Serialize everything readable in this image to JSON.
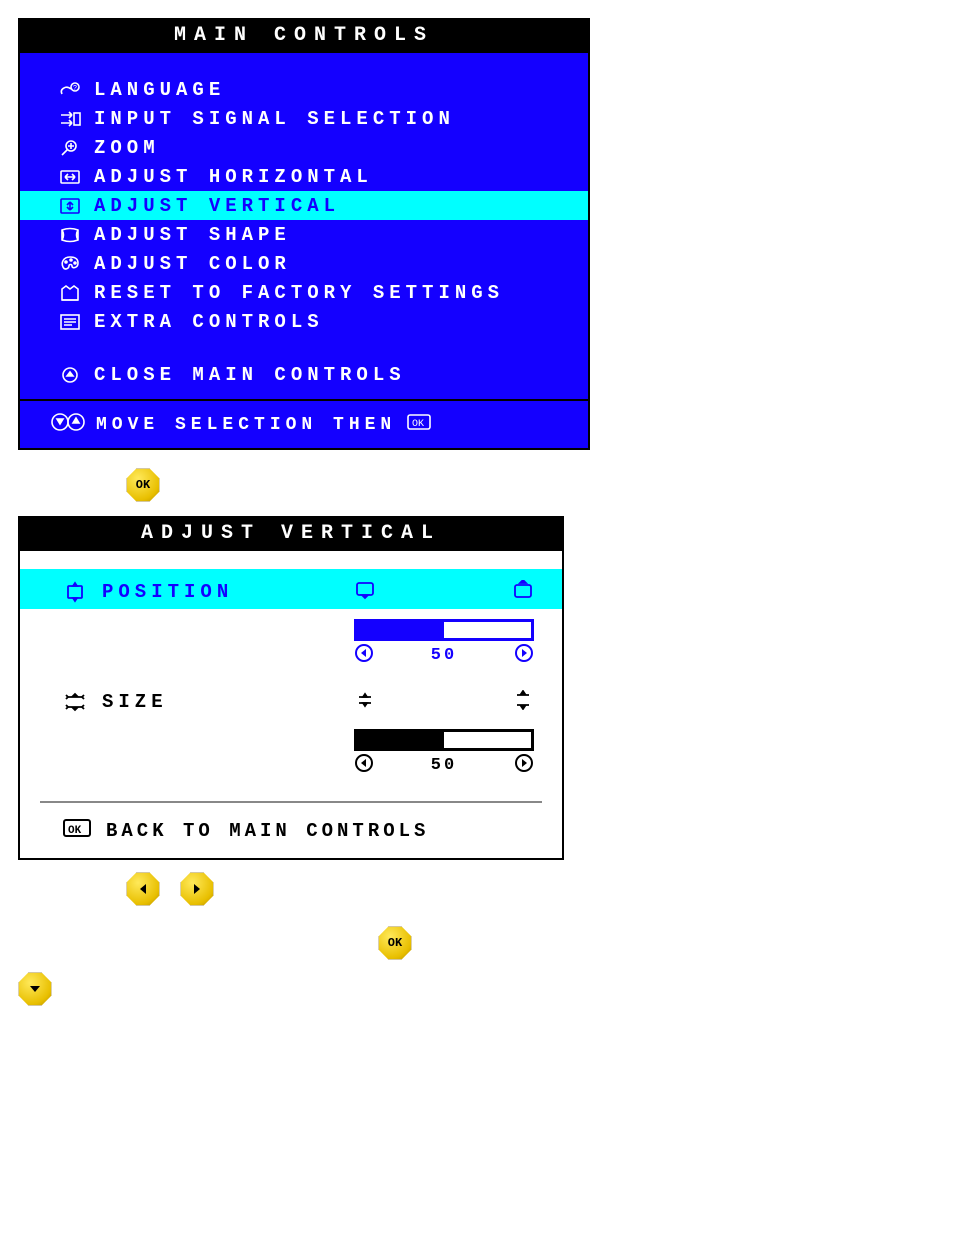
{
  "main_controls": {
    "title": "MAIN CONTROLS",
    "items": [
      {
        "icon": "language",
        "label": "LANGUAGE"
      },
      {
        "icon": "input",
        "label": "INPUT SIGNAL SELECTION"
      },
      {
        "icon": "zoom",
        "label": "ZOOM"
      },
      {
        "icon": "adj-h",
        "label": "ADJUST HORIZONTAL"
      },
      {
        "icon": "adj-v",
        "label": "ADJUST VERTICAL",
        "selected": true
      },
      {
        "icon": "shape",
        "label": "ADJUST SHAPE"
      },
      {
        "icon": "color",
        "label": "ADJUST COLOR"
      },
      {
        "icon": "reset",
        "label": "RESET TO FACTORY SETTINGS"
      },
      {
        "icon": "extra",
        "label": "EXTRA CONTROLS"
      }
    ],
    "close_label": "CLOSE MAIN CONTROLS",
    "footer_label": "MOVE SELECTION THEN"
  },
  "adjust_vertical": {
    "title": "ADJUST VERTICAL",
    "position": {
      "label": "POSITION",
      "value": 50,
      "selected": true
    },
    "size": {
      "label": "SIZE",
      "value": 50,
      "selected": false
    },
    "back_label": "BACK TO MAIN CONTROLS"
  },
  "buttons": {
    "ok": "OK"
  }
}
